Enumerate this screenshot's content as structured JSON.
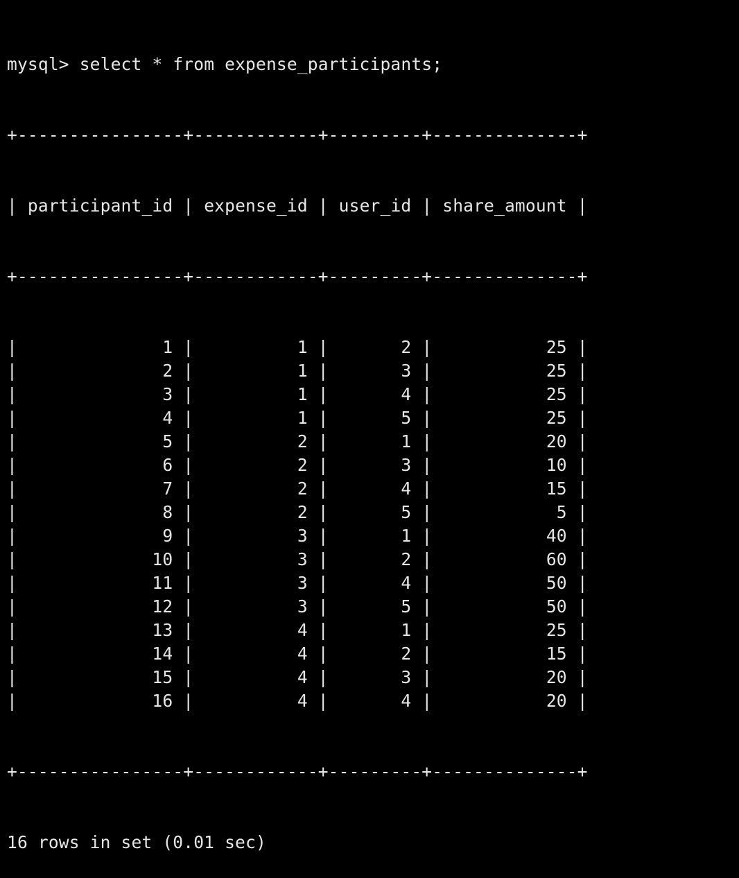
{
  "terminal": {
    "prompt": "mysql>",
    "command": "select * from expense_participants;",
    "border": "+----------------+------------+---------+--------------+",
    "columns": [
      "participant_id",
      "expense_id",
      "user_id",
      "share_amount"
    ],
    "rows": [
      [
        1,
        1,
        2,
        25
      ],
      [
        2,
        1,
        3,
        25
      ],
      [
        3,
        1,
        4,
        25
      ],
      [
        4,
        1,
        5,
        25
      ],
      [
        5,
        2,
        1,
        20
      ],
      [
        6,
        2,
        3,
        10
      ],
      [
        7,
        2,
        4,
        15
      ],
      [
        8,
        2,
        5,
        5
      ],
      [
        9,
        3,
        1,
        40
      ],
      [
        10,
        3,
        2,
        60
      ],
      [
        11,
        3,
        4,
        50
      ],
      [
        12,
        3,
        5,
        50
      ],
      [
        13,
        4,
        1,
        25
      ],
      [
        14,
        4,
        2,
        15
      ],
      [
        15,
        4,
        3,
        20
      ],
      [
        16,
        4,
        4,
        20
      ]
    ],
    "footer": "16 rows in set (0.01 sec)"
  }
}
